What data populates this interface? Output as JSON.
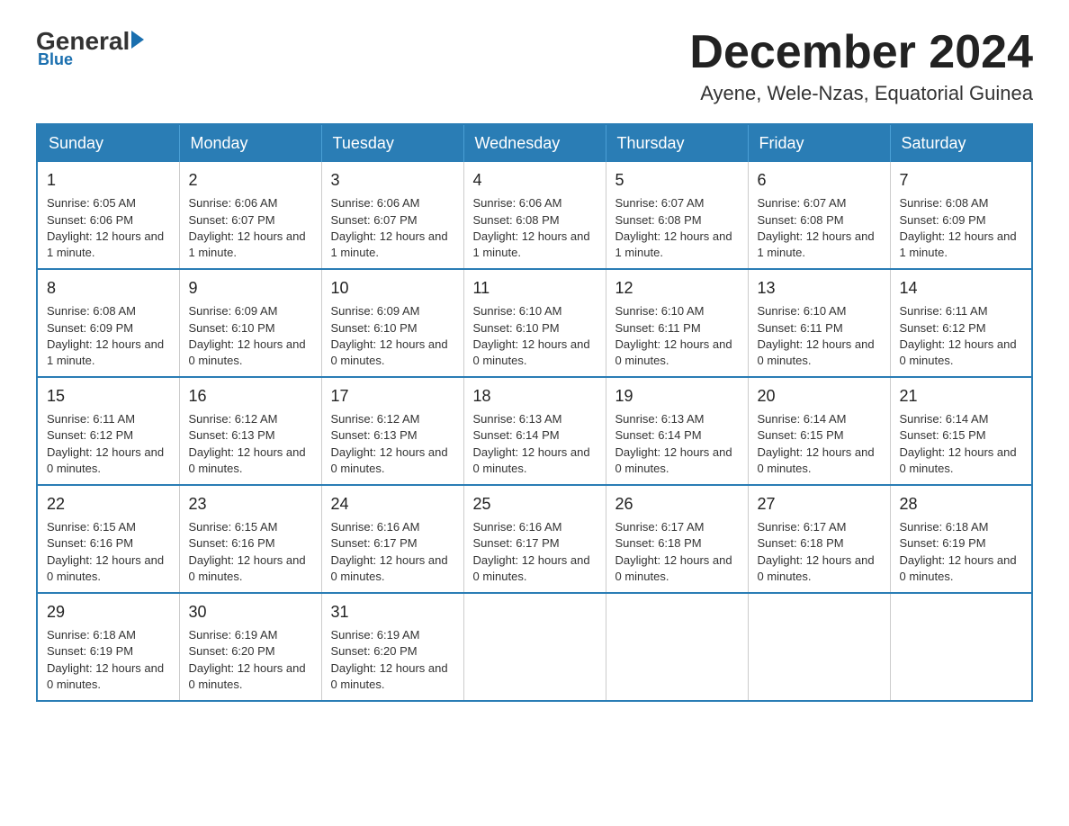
{
  "logo": {
    "general": "General",
    "blue": "Blue"
  },
  "title": {
    "month": "December 2024",
    "location": "Ayene, Wele-Nzas, Equatorial Guinea"
  },
  "headers": [
    "Sunday",
    "Monday",
    "Tuesday",
    "Wednesday",
    "Thursday",
    "Friday",
    "Saturday"
  ],
  "weeks": [
    [
      {
        "day": "1",
        "sunrise": "6:05 AM",
        "sunset": "6:06 PM",
        "daylight": "12 hours and 1 minute."
      },
      {
        "day": "2",
        "sunrise": "6:06 AM",
        "sunset": "6:07 PM",
        "daylight": "12 hours and 1 minute."
      },
      {
        "day": "3",
        "sunrise": "6:06 AM",
        "sunset": "6:07 PM",
        "daylight": "12 hours and 1 minute."
      },
      {
        "day": "4",
        "sunrise": "6:06 AM",
        "sunset": "6:08 PM",
        "daylight": "12 hours and 1 minute."
      },
      {
        "day": "5",
        "sunrise": "6:07 AM",
        "sunset": "6:08 PM",
        "daylight": "12 hours and 1 minute."
      },
      {
        "day": "6",
        "sunrise": "6:07 AM",
        "sunset": "6:08 PM",
        "daylight": "12 hours and 1 minute."
      },
      {
        "day": "7",
        "sunrise": "6:08 AM",
        "sunset": "6:09 PM",
        "daylight": "12 hours and 1 minute."
      }
    ],
    [
      {
        "day": "8",
        "sunrise": "6:08 AM",
        "sunset": "6:09 PM",
        "daylight": "12 hours and 1 minute."
      },
      {
        "day": "9",
        "sunrise": "6:09 AM",
        "sunset": "6:10 PM",
        "daylight": "12 hours and 0 minutes."
      },
      {
        "day": "10",
        "sunrise": "6:09 AM",
        "sunset": "6:10 PM",
        "daylight": "12 hours and 0 minutes."
      },
      {
        "day": "11",
        "sunrise": "6:10 AM",
        "sunset": "6:10 PM",
        "daylight": "12 hours and 0 minutes."
      },
      {
        "day": "12",
        "sunrise": "6:10 AM",
        "sunset": "6:11 PM",
        "daylight": "12 hours and 0 minutes."
      },
      {
        "day": "13",
        "sunrise": "6:10 AM",
        "sunset": "6:11 PM",
        "daylight": "12 hours and 0 minutes."
      },
      {
        "day": "14",
        "sunrise": "6:11 AM",
        "sunset": "6:12 PM",
        "daylight": "12 hours and 0 minutes."
      }
    ],
    [
      {
        "day": "15",
        "sunrise": "6:11 AM",
        "sunset": "6:12 PM",
        "daylight": "12 hours and 0 minutes."
      },
      {
        "day": "16",
        "sunrise": "6:12 AM",
        "sunset": "6:13 PM",
        "daylight": "12 hours and 0 minutes."
      },
      {
        "day": "17",
        "sunrise": "6:12 AM",
        "sunset": "6:13 PM",
        "daylight": "12 hours and 0 minutes."
      },
      {
        "day": "18",
        "sunrise": "6:13 AM",
        "sunset": "6:14 PM",
        "daylight": "12 hours and 0 minutes."
      },
      {
        "day": "19",
        "sunrise": "6:13 AM",
        "sunset": "6:14 PM",
        "daylight": "12 hours and 0 minutes."
      },
      {
        "day": "20",
        "sunrise": "6:14 AM",
        "sunset": "6:15 PM",
        "daylight": "12 hours and 0 minutes."
      },
      {
        "day": "21",
        "sunrise": "6:14 AM",
        "sunset": "6:15 PM",
        "daylight": "12 hours and 0 minutes."
      }
    ],
    [
      {
        "day": "22",
        "sunrise": "6:15 AM",
        "sunset": "6:16 PM",
        "daylight": "12 hours and 0 minutes."
      },
      {
        "day": "23",
        "sunrise": "6:15 AM",
        "sunset": "6:16 PM",
        "daylight": "12 hours and 0 minutes."
      },
      {
        "day": "24",
        "sunrise": "6:16 AM",
        "sunset": "6:17 PM",
        "daylight": "12 hours and 0 minutes."
      },
      {
        "day": "25",
        "sunrise": "6:16 AM",
        "sunset": "6:17 PM",
        "daylight": "12 hours and 0 minutes."
      },
      {
        "day": "26",
        "sunrise": "6:17 AM",
        "sunset": "6:18 PM",
        "daylight": "12 hours and 0 minutes."
      },
      {
        "day": "27",
        "sunrise": "6:17 AM",
        "sunset": "6:18 PM",
        "daylight": "12 hours and 0 minutes."
      },
      {
        "day": "28",
        "sunrise": "6:18 AM",
        "sunset": "6:19 PM",
        "daylight": "12 hours and 0 minutes."
      }
    ],
    [
      {
        "day": "29",
        "sunrise": "6:18 AM",
        "sunset": "6:19 PM",
        "daylight": "12 hours and 0 minutes."
      },
      {
        "day": "30",
        "sunrise": "6:19 AM",
        "sunset": "6:20 PM",
        "daylight": "12 hours and 0 minutes."
      },
      {
        "day": "31",
        "sunrise": "6:19 AM",
        "sunset": "6:20 PM",
        "daylight": "12 hours and 0 minutes."
      },
      null,
      null,
      null,
      null
    ]
  ],
  "labels": {
    "sunrise": "Sunrise:",
    "sunset": "Sunset:",
    "daylight": "Daylight:"
  }
}
